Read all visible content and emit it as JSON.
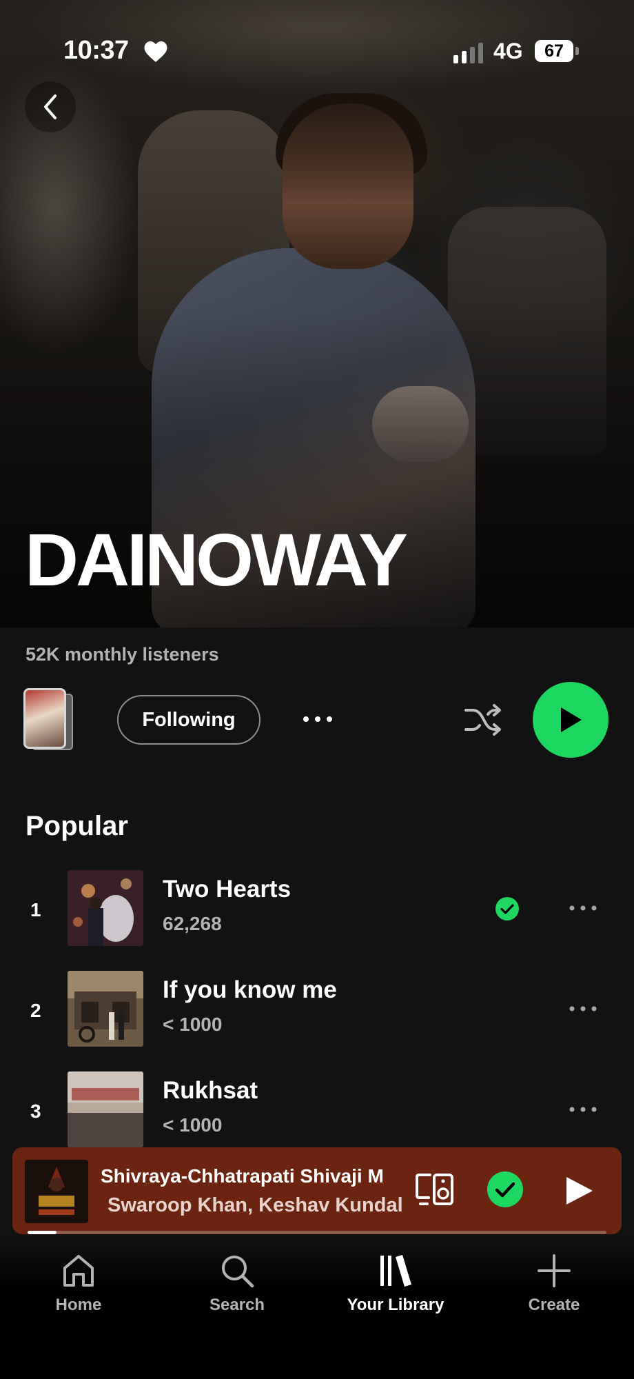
{
  "status_bar": {
    "time": "10:37",
    "network": "4G",
    "battery": "67",
    "icons": [
      "heart-icon",
      "signal-icon"
    ]
  },
  "artist": {
    "name": "DAINOWAY",
    "monthly_listeners": "52K monthly listeners"
  },
  "actions": {
    "follow_label": "Following",
    "icons": [
      "more-icon",
      "shuffle-icon",
      "play-icon"
    ]
  },
  "popular": {
    "title": "Popular",
    "tracks": [
      {
        "number": "1",
        "title": "Two Hearts",
        "plays": "62,268",
        "saved": true
      },
      {
        "number": "2",
        "title": "If you know me",
        "plays": "< 1000",
        "saved": false
      },
      {
        "number": "3",
        "title": "Rukhsat",
        "plays": "< 1000",
        "saved": false
      }
    ]
  },
  "now_playing": {
    "title": "Shivraya-Chhatrapati Shivaji M",
    "artist": "Swaroop Khan, Keshav Kundal",
    "progress": 0.05
  },
  "nav": {
    "items": [
      {
        "label": "Home",
        "icon": "home-icon"
      },
      {
        "label": "Search",
        "icon": "search-icon"
      },
      {
        "label": "Your Library",
        "icon": "library-icon",
        "active": true
      },
      {
        "label": "Create",
        "icon": "plus-icon"
      }
    ]
  },
  "colors": {
    "accent_green": "#1ed760",
    "mini_player_bg": "#6b2410",
    "background": "#121212"
  }
}
